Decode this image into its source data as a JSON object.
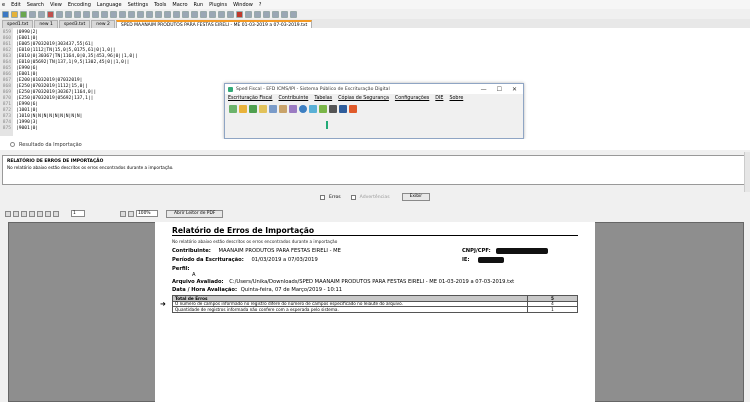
{
  "npp": {
    "menu": [
      "e",
      "Edit",
      "Search",
      "View",
      "Encoding",
      "Language",
      "Settings",
      "Tools",
      "Macro",
      "Run",
      "Plugins",
      "Window",
      "?"
    ],
    "tabs": [
      "sped1.txt",
      "new 1",
      "sped3.txt",
      "new 2",
      "SPED MAANAIM PRODUTOS PARA FESTAS EIRELI - ME 01-03-2019 a 07-03-2019.txt"
    ],
    "lines": [
      {
        "n": "859",
        "t": "|0990|2|"
      },
      {
        "n": "860",
        "t": "|E001|0|"
      },
      {
        "n": "861",
        "t": "|E005|07032019|303437,55|61|"
      },
      {
        "n": "862",
        "t": "|E010|1112|TN|15,0|5,0175,61|0|1,0||"
      },
      {
        "n": "863",
        "t": "|E010|0|30367|TN|1164,0|0,35|453,96|0||1,0||"
      },
      {
        "n": "864",
        "t": "|E010|05692|TN|137,1|9,5|1302,45|0||1,0||"
      },
      {
        "n": "865",
        "t": "|E990|6|"
      },
      {
        "n": "866",
        "t": "|E001|0|"
      },
      {
        "n": "867",
        "t": "|E200|01032019|07032019|"
      },
      {
        "n": "868",
        "t": "|E250|07032019|1112|15,0||"
      },
      {
        "n": "869",
        "t": "|E250|07032019|30367|1164,0||"
      },
      {
        "n": "870",
        "t": "|E250|07032019|05692|137,1||"
      },
      {
        "n": "871",
        "t": "|E990|6|"
      },
      {
        "n": "872",
        "t": "|1001|0|"
      },
      {
        "n": "873",
        "t": "|1010|N|N|N|N|N|N|N|N|N|"
      },
      {
        "n": "874",
        "t": "|1990|3|"
      },
      {
        "n": "875",
        "t": "|9001|0|"
      }
    ]
  },
  "sped": {
    "title": "Sped Fiscal - EFD ICMS/IPI - Sistema Público de Escrituração Digital",
    "menu": [
      "Escrituração Fiscal",
      "Contribuinte",
      "Tabelas",
      "Cópias de Segurança",
      "Configurações",
      "DIE",
      "Sobre"
    ],
    "controls": [
      "—",
      "☐",
      "✕"
    ]
  },
  "result": {
    "title": "Resultado da Importação",
    "panel_title": "RELATÓRIO DE ERROS DE IMPORTAÇÃO",
    "panel_sub": "No relatório abaixo estão descritos os erros encontrados durante a importação.",
    "filter_erros": "Erros",
    "filter_adv": "Advertências",
    "exibir": "Exibir",
    "zoom": "100%",
    "abrir": "Abrir Leitor de PDF",
    "page_num": "1"
  },
  "report": {
    "title": "Relatório de Erros de Importação",
    "subtitle": "No relatório abaixo estão descritos os erros encontrados durante a importação",
    "contribuinte_label": "Contribuinte:",
    "contribuinte": "MAANAIM PRODUTOS PARA FESTAS EIRELI - ME",
    "cnpj_label": "CNPJ/CPF:",
    "ie_label": "IE:",
    "periodo_label": "Período da Escrituração:",
    "periodo": "01/03/2019 a 07/03/2019",
    "perfil_label": "Perfil:",
    "perfil": "A",
    "arquivo_label": "Arquivo Avaliado:",
    "arquivo": "C:/Users/Unika/Downloads/SPED MAANAIM PRODUTOS PARA FESTAS EIRELI - ME 01-03-2019 a 07-03-2019.txt",
    "data_label": "Data / Hora Avaliação:",
    "data": "Quinta-feira, 07 de Março/2019 - 10:11",
    "total_label": "Total de Erros",
    "total": "5",
    "rows": [
      {
        "desc": "O número de campos informado no registro difere do número de campos especificado no leiaute do arquivo.",
        "count": "4"
      },
      {
        "desc": "Quantidade de registros informada não confere com a esperada pelo sistema.",
        "count": "1"
      }
    ]
  }
}
